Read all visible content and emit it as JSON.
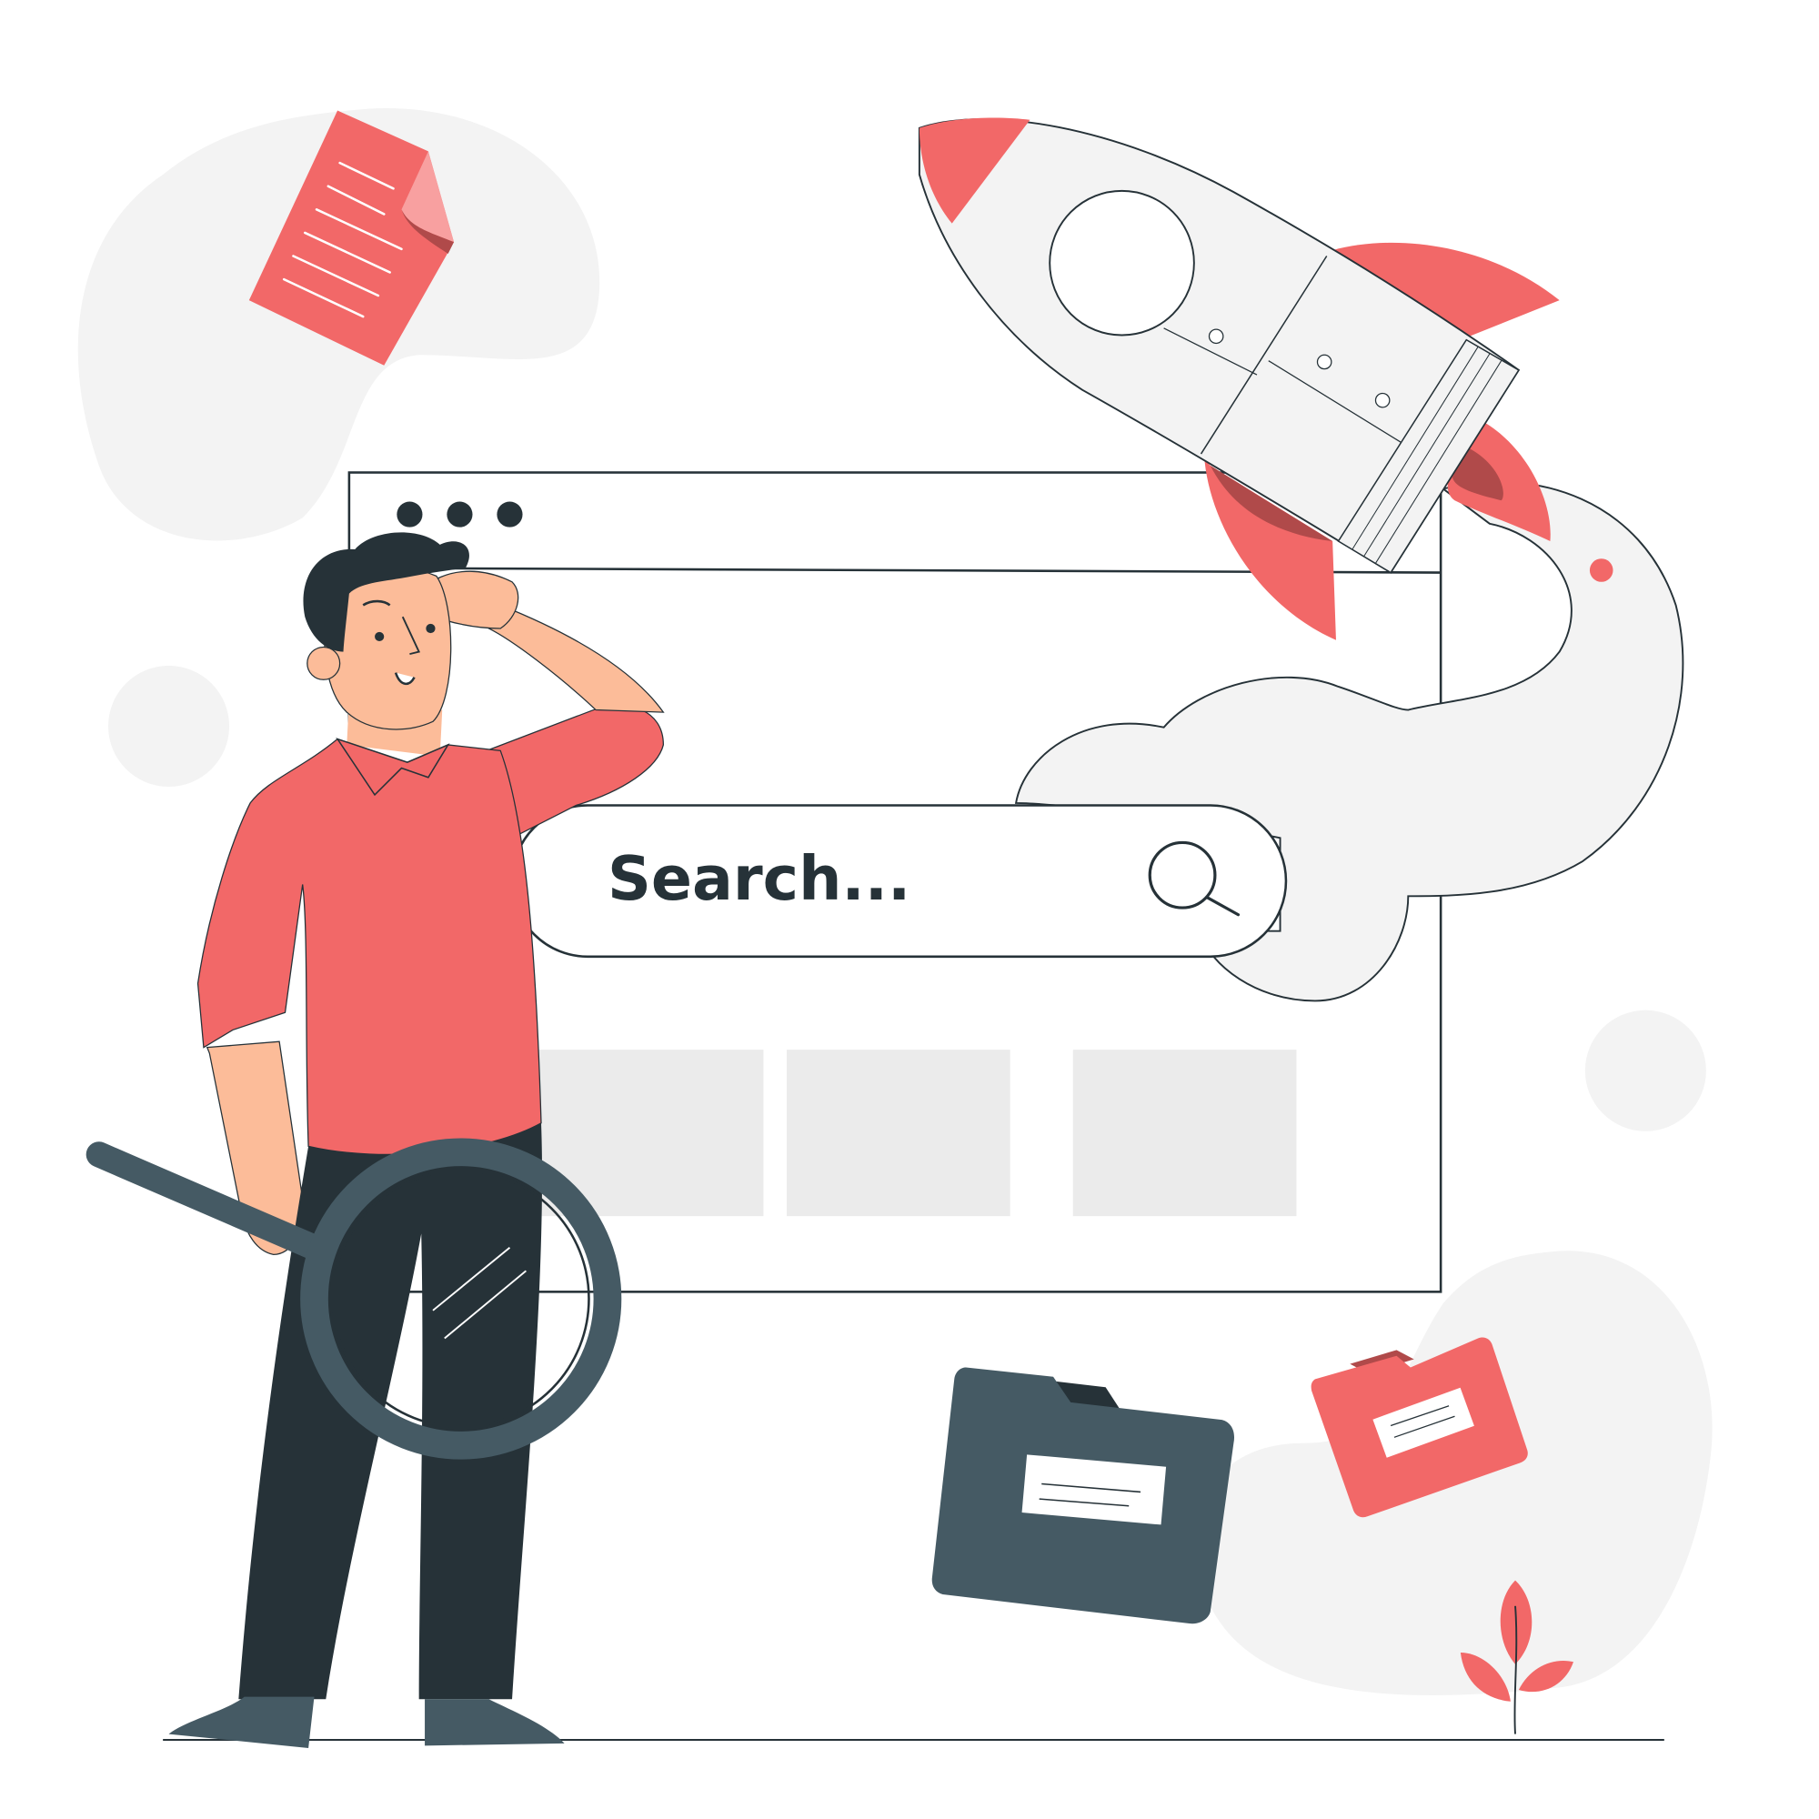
{
  "search": {
    "placeholder": "Search..."
  },
  "icons": {
    "search": "search-icon",
    "magnifier": "magnifying-glass-icon",
    "rocket": "rocket-icon",
    "document": "document-icon",
    "folder_dark": "folder-icon",
    "folder_red": "folder-icon",
    "plant": "plant-icon"
  },
  "palette": {
    "accent": "#f26868",
    "dark": "#263238",
    "slate": "#455a64",
    "light_gray": "#f3f3f3",
    "skin": "#fcbc99",
    "placeholder_block": "#ebebeb"
  },
  "results": {
    "count": 3
  }
}
